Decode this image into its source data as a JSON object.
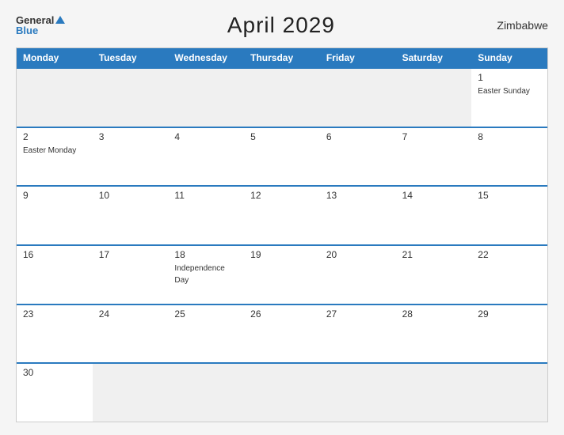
{
  "header": {
    "logo_general": "General",
    "logo_blue": "Blue",
    "title": "April 2029",
    "country": "Zimbabwe"
  },
  "days_of_week": [
    "Monday",
    "Tuesday",
    "Wednesday",
    "Thursday",
    "Friday",
    "Saturday",
    "Sunday"
  ],
  "rows": [
    [
      {
        "day": "",
        "event": "",
        "empty": true
      },
      {
        "day": "",
        "event": "",
        "empty": true
      },
      {
        "day": "",
        "event": "",
        "empty": true
      },
      {
        "day": "",
        "event": "",
        "empty": true
      },
      {
        "day": "",
        "event": "",
        "empty": true
      },
      {
        "day": "",
        "event": "",
        "empty": true
      },
      {
        "day": "1",
        "event": "Easter Sunday",
        "empty": false
      }
    ],
    [
      {
        "day": "2",
        "event": "Easter Monday",
        "empty": false
      },
      {
        "day": "3",
        "event": "",
        "empty": false
      },
      {
        "day": "4",
        "event": "",
        "empty": false
      },
      {
        "day": "5",
        "event": "",
        "empty": false
      },
      {
        "day": "6",
        "event": "",
        "empty": false
      },
      {
        "day": "7",
        "event": "",
        "empty": false
      },
      {
        "day": "8",
        "event": "",
        "empty": false
      }
    ],
    [
      {
        "day": "9",
        "event": "",
        "empty": false
      },
      {
        "day": "10",
        "event": "",
        "empty": false
      },
      {
        "day": "11",
        "event": "",
        "empty": false
      },
      {
        "day": "12",
        "event": "",
        "empty": false
      },
      {
        "day": "13",
        "event": "",
        "empty": false
      },
      {
        "day": "14",
        "event": "",
        "empty": false
      },
      {
        "day": "15",
        "event": "",
        "empty": false
      }
    ],
    [
      {
        "day": "16",
        "event": "",
        "empty": false
      },
      {
        "day": "17",
        "event": "",
        "empty": false
      },
      {
        "day": "18",
        "event": "Independence Day",
        "empty": false
      },
      {
        "day": "19",
        "event": "",
        "empty": false
      },
      {
        "day": "20",
        "event": "",
        "empty": false
      },
      {
        "day": "21",
        "event": "",
        "empty": false
      },
      {
        "day": "22",
        "event": "",
        "empty": false
      }
    ],
    [
      {
        "day": "23",
        "event": "",
        "empty": false
      },
      {
        "day": "24",
        "event": "",
        "empty": false
      },
      {
        "day": "25",
        "event": "",
        "empty": false
      },
      {
        "day": "26",
        "event": "",
        "empty": false
      },
      {
        "day": "27",
        "event": "",
        "empty": false
      },
      {
        "day": "28",
        "event": "",
        "empty": false
      },
      {
        "day": "29",
        "event": "",
        "empty": false
      }
    ],
    [
      {
        "day": "30",
        "event": "",
        "empty": false
      },
      {
        "day": "",
        "event": "",
        "empty": true
      },
      {
        "day": "",
        "event": "",
        "empty": true
      },
      {
        "day": "",
        "event": "",
        "empty": true
      },
      {
        "day": "",
        "event": "",
        "empty": true
      },
      {
        "day": "",
        "event": "",
        "empty": true
      },
      {
        "day": "",
        "event": "",
        "empty": true
      }
    ]
  ]
}
